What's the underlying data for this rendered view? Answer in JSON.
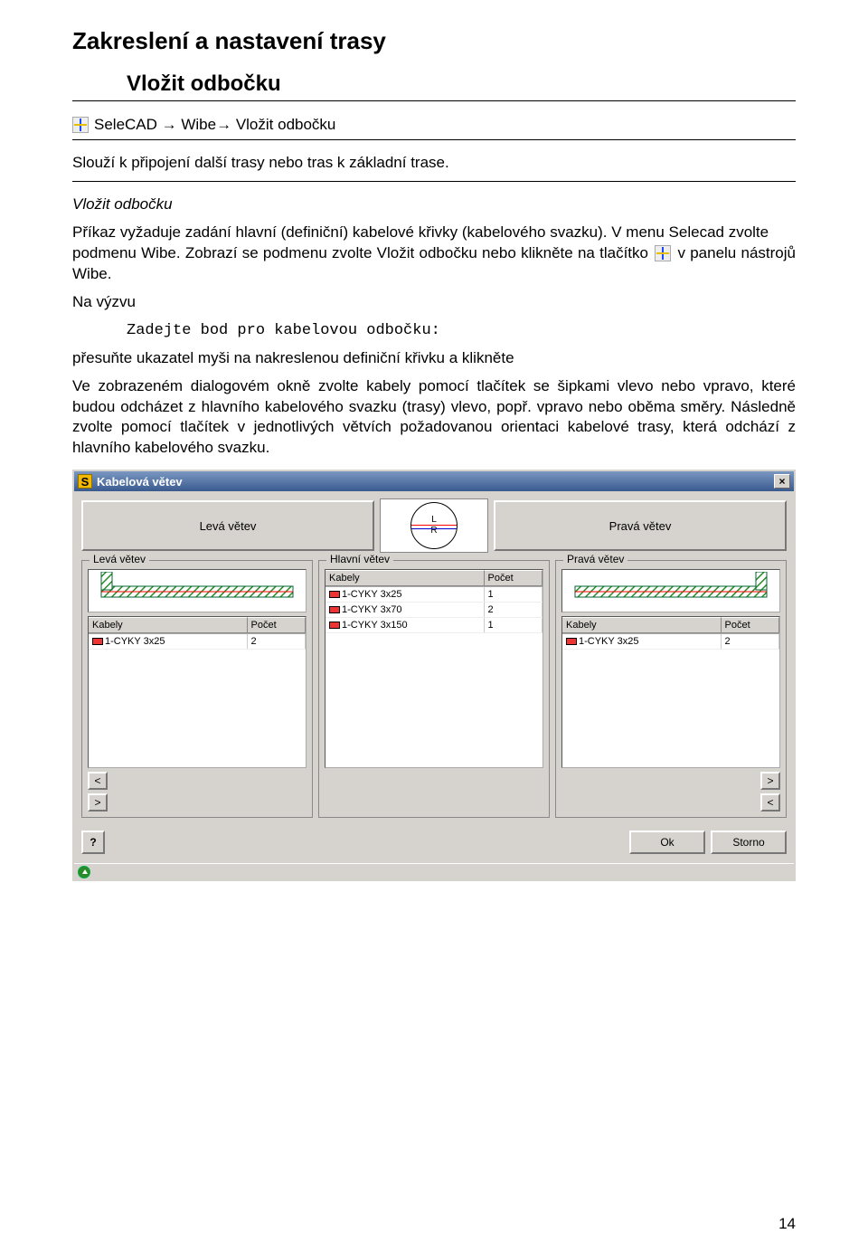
{
  "headings": {
    "main": "Zakreslení a nastavení trasy",
    "sub": "Vložit odbočku"
  },
  "breadcrumb": {
    "icon_name": "cross-icon",
    "text": "SeleCAD → Wibe→ Vložit odbočku"
  },
  "paragraphs": {
    "p1": "Slouží k připojení další trasy nebo tras k základní trase.",
    "p2_title": "Vložit odbočku",
    "p3a": "Příkaz vyžaduje zadání hlavní (definiční) kabelové křivky (kabelového svazku). V menu Selecad zvolte",
    "p3b": "podmenu Wibe. Zobrazí se podmenu zvolte Vložit odbočku nebo klikněte na tlačítko ",
    "p3c": " v panelu nástrojů Wibe.",
    "p4": "Na výzvu",
    "code": "Zadejte bod pro kabelovou odbočku:",
    "p5": "přesuňte ukazatel myši na nakreslenou definiční křivku a klikněte",
    "p6": "Ve zobrazeném dialogovém okně zvolte kabely pomocí tlačítek se šipkami vlevo nebo vpravo, které budou odcházet z hlavního kabelového svazku (trasy) vlevo, popř. vpravo nebo oběma směry. Následně zvolte pomocí tlačítek v jednotlivých větvích požadovanou orientaci kabelové trasy, která odchází z hlavního kabelového svazku."
  },
  "dialog": {
    "title": "Kabelová větev",
    "close": "×",
    "top_buttons": {
      "left": "Levá větev",
      "right": "Pravá větev"
    },
    "lr_labels": {
      "l": "L",
      "r": "R"
    },
    "groups": {
      "left": {
        "legend": "Levá větev",
        "headers": {
          "c1": "Kabely",
          "c2": "Počet"
        },
        "rows": [
          {
            "cable": "1-CYKY 3x25",
            "count": "2"
          }
        ],
        "move": {
          "to_left": "<",
          "to_right": ">"
        }
      },
      "main": {
        "legend": "Hlavní větev",
        "headers": {
          "c1": "Kabely",
          "c2": "Počet"
        },
        "rows": [
          {
            "cable": "1-CYKY 3x25",
            "count": "1"
          },
          {
            "cable": "1-CYKY 3x70",
            "count": "2"
          },
          {
            "cable": "1-CYKY 3x150",
            "count": "1"
          }
        ]
      },
      "right": {
        "legend": "Pravá větev",
        "headers": {
          "c1": "Kabely",
          "c2": "Počet"
        },
        "rows": [
          {
            "cable": "1-CYKY 3x25",
            "count": "2"
          }
        ],
        "move": {
          "to_right": ">",
          "to_left": "<"
        }
      }
    },
    "footer": {
      "help": "?",
      "ok": "Ok",
      "cancel": "Storno"
    }
  },
  "page_number": "14"
}
